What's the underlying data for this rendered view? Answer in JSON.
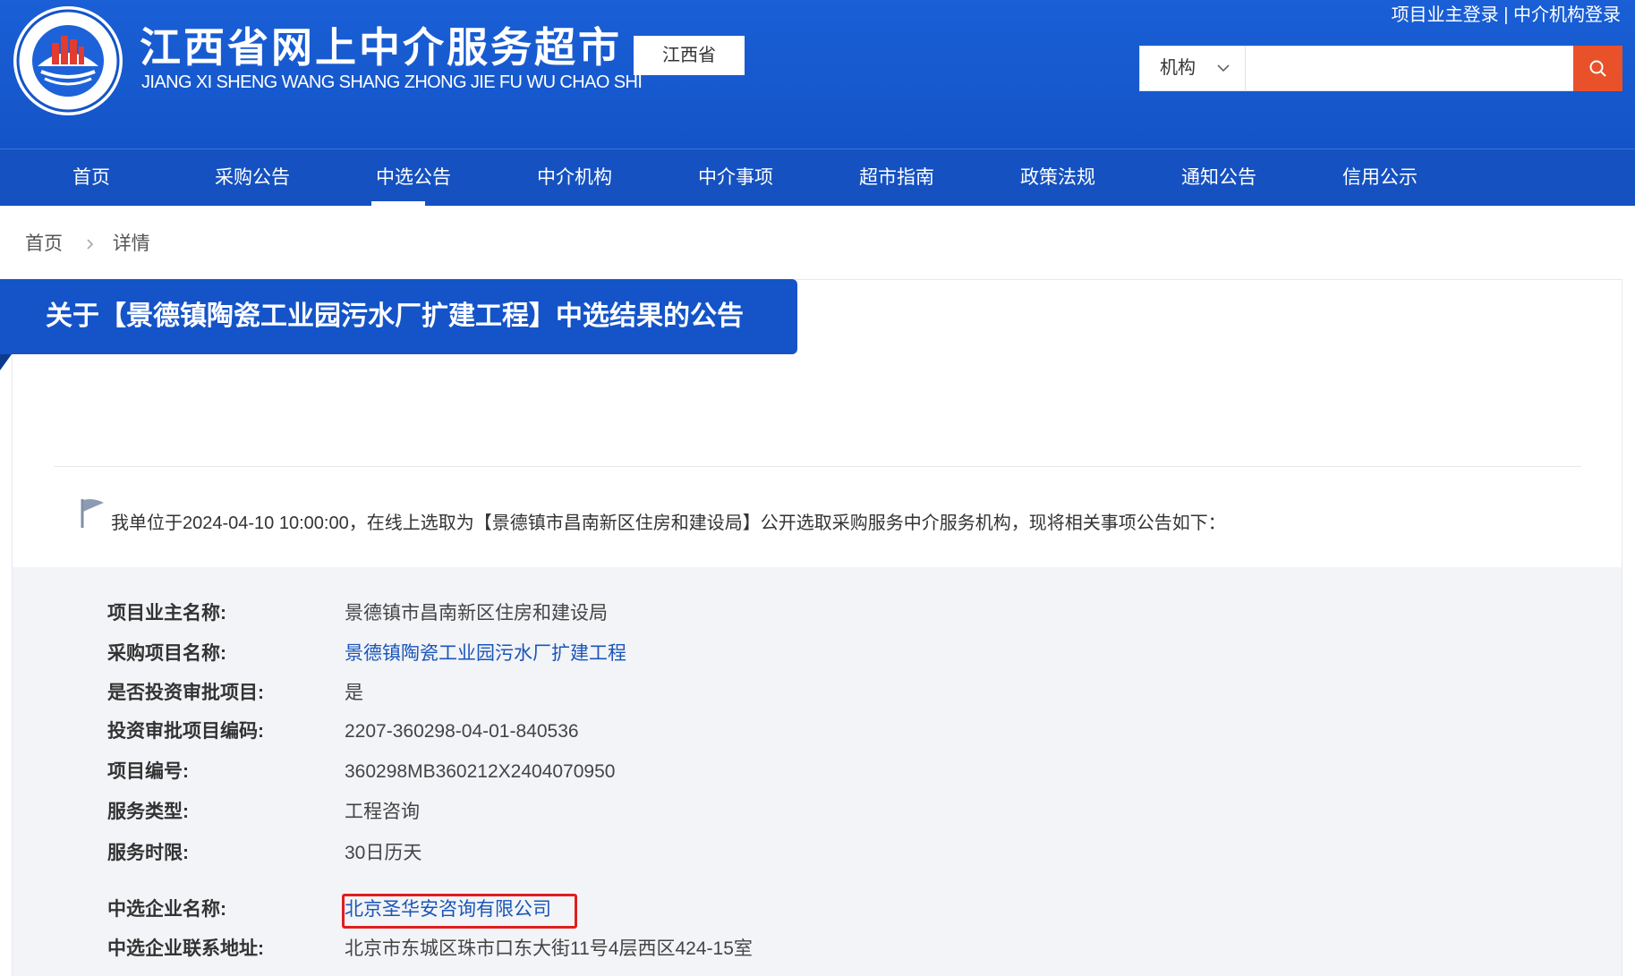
{
  "header": {
    "site_title": "江西省网上中介服务超市",
    "site_subtitle": "JIANG XI SHENG WANG SHANG ZHONG JIE FU WU CHAO SHI",
    "region": "江西省",
    "owner_login": "项目业主登录",
    "link_separator": "|",
    "agency_login": "中介机构登录"
  },
  "search": {
    "category": "机构",
    "value": "",
    "placeholder": ""
  },
  "nav": {
    "items": [
      "首页",
      "采购公告",
      "中选公告",
      "中介机构",
      "中介事项",
      "超市指南",
      "政策法规",
      "通知公告",
      "信用公示"
    ],
    "active": "中选公告"
  },
  "breadcrumb": {
    "home": "首页",
    "current": "详情"
  },
  "notice": {
    "title": "关于【景德镇陶瓷工业园污水厂扩建工程】中选结果的公告",
    "intro": "我单位于2024-04-10 10:00:00，在线上选取为【景德镇市昌南新区住房和建设局】公开选取采购服务中介服务机构，现将相关事项公告如下：",
    "fields": [
      {
        "label": "项目业主名称:",
        "value": "景德镇市昌南新区住房和建设局"
      },
      {
        "label": "采购项目名称:",
        "value": "景德镇陶瓷工业园污水厂扩建工程"
      },
      {
        "label": "是否投资审批项目:",
        "value": "是"
      },
      {
        "label": "投资审批项目编码:",
        "value": "2207-360298-04-01-840536"
      },
      {
        "label": "项目编号:",
        "value": "360298MB360212X2404070950"
      },
      {
        "label": "服务类型:",
        "value": "工程咨询"
      },
      {
        "label": "服务时限:",
        "value": "30日历天"
      },
      {
        "label": "中选企业名称:",
        "value": "北京圣华安咨询有限公司"
      },
      {
        "label": "中选企业联系地址:",
        "value": "北京市东城区珠市口东大街11号4层西区424-15室"
      }
    ]
  },
  "colors": {
    "header_blue": "#1454c8",
    "search_button": "#e9512a",
    "link_blue": "#1b55b8",
    "highlight_red": "#e21d1d"
  },
  "icons": [
    "emblem-logo",
    "chevron-down-icon",
    "search-icon",
    "chevron-right-icon",
    "flag-icon"
  ]
}
